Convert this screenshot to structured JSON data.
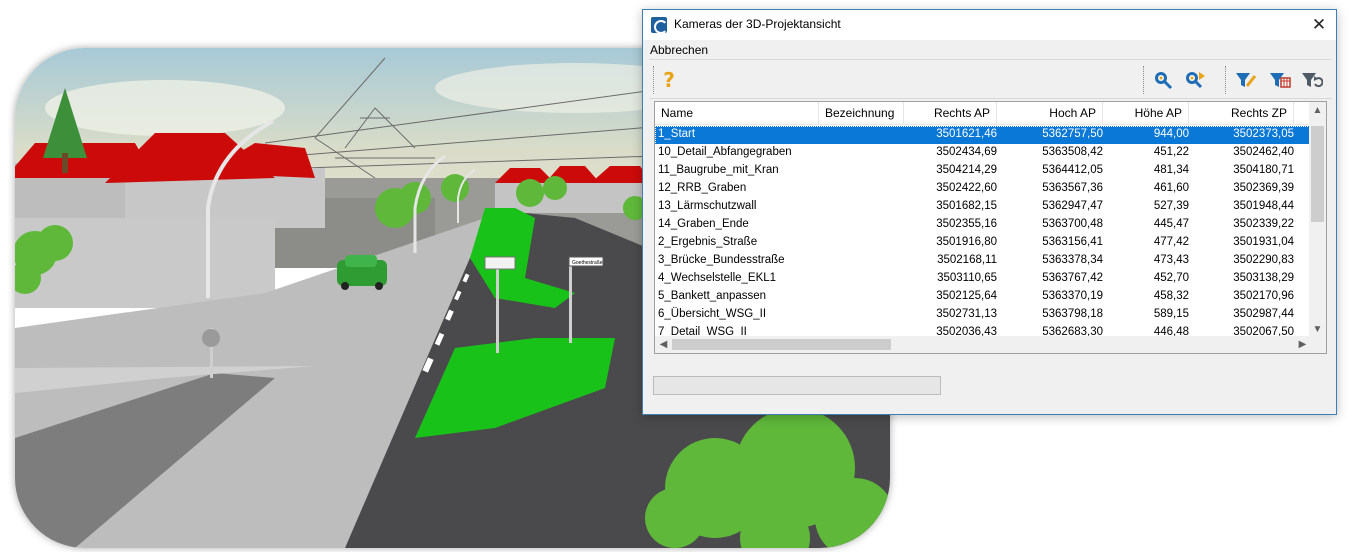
{
  "dialog": {
    "title": "Kameras der 3D-Projektansicht",
    "close_glyph": "✕",
    "menu": {
      "cancel_label": "Abbrechen"
    },
    "toolbar": {
      "help_glyph": "?",
      "buttons": [
        "help-icon",
        "zoom-to-icon",
        "zoom-next-icon",
        "filter-edit-icon",
        "filter-table-icon",
        "filter-reset-icon"
      ]
    },
    "colors": {
      "accent": "#3c7fb1",
      "selection": "#0a78d7",
      "help": "#e8a317",
      "tool_blue": "#1e6db5"
    }
  },
  "table": {
    "columns": [
      "Name",
      "Bezeichnung",
      "Rechts AP",
      "Hoch AP",
      "Höhe AP",
      "Rechts ZP"
    ],
    "selected_index": 0,
    "rows": [
      {
        "name": "1_Start",
        "bez": "",
        "rechts_ap": "3501621,46",
        "hoch_ap": "5362757,50",
        "hoehe_ap": "944,00",
        "rechts_zp": "3502373,05"
      },
      {
        "name": "10_Detail_Abfangegraben",
        "bez": "",
        "rechts_ap": "3502434,69",
        "hoch_ap": "5363508,42",
        "hoehe_ap": "451,22",
        "rechts_zp": "3502462,40"
      },
      {
        "name": "11_Baugrube_mit_Kran",
        "bez": "",
        "rechts_ap": "3504214,29",
        "hoch_ap": "5364412,05",
        "hoehe_ap": "481,34",
        "rechts_zp": "3504180,71"
      },
      {
        "name": "12_RRB_Graben",
        "bez": "",
        "rechts_ap": "3502422,60",
        "hoch_ap": "5363567,36",
        "hoehe_ap": "461,60",
        "rechts_zp": "3502369,39"
      },
      {
        "name": "13_Lärmschutzwall",
        "bez": "",
        "rechts_ap": "3501682,15",
        "hoch_ap": "5362947,47",
        "hoehe_ap": "527,39",
        "rechts_zp": "3501948,44"
      },
      {
        "name": "14_Graben_Ende",
        "bez": "",
        "rechts_ap": "3502355,16",
        "hoch_ap": "5363700,48",
        "hoehe_ap": "445,47",
        "rechts_zp": "3502339,22"
      },
      {
        "name": "2_Ergebnis_Straße",
        "bez": "",
        "rechts_ap": "3501916,80",
        "hoch_ap": "5363156,41",
        "hoehe_ap": "477,42",
        "rechts_zp": "3501931,04"
      },
      {
        "name": "3_Brücke_Bundesstraße",
        "bez": "",
        "rechts_ap": "3502168,11",
        "hoch_ap": "5363378,34",
        "hoehe_ap": "473,43",
        "rechts_zp": "3502290,83"
      },
      {
        "name": "4_Wechselstelle_EKL1",
        "bez": "",
        "rechts_ap": "3503110,65",
        "hoch_ap": "5363767,42",
        "hoehe_ap": "452,70",
        "rechts_zp": "3503138,29"
      },
      {
        "name": "5_Bankett_anpassen",
        "bez": "",
        "rechts_ap": "3502125,64",
        "hoch_ap": "5363370,19",
        "hoehe_ap": "458,32",
        "rechts_zp": "3502170,96"
      },
      {
        "name": "6_Übersicht_WSG_II",
        "bez": "",
        "rechts_ap": "3502731,13",
        "hoch_ap": "5363798,18",
        "hoehe_ap": "589,15",
        "rechts_zp": "3502987,44"
      },
      {
        "name": "7_Detail_WSG_II",
        "bez": "",
        "rechts_ap": "3502036,43",
        "hoch_ap": "5362683,30",
        "hoehe_ap": "446,48",
        "rechts_zp": "3502067,50"
      }
    ],
    "scroll_glyphs": {
      "up": "▲",
      "down": "▼",
      "left": "◀",
      "right": "▶"
    }
  },
  "progress": {
    "value": 0
  },
  "scene": {
    "street_sign_text": "Goethestraße",
    "colors": {
      "roof": "#cc0a0a",
      "grass": "#19c219",
      "road_dark": "#4a4a4c",
      "road_light": "#bdbdbd",
      "tree": "#5fb83a"
    }
  }
}
